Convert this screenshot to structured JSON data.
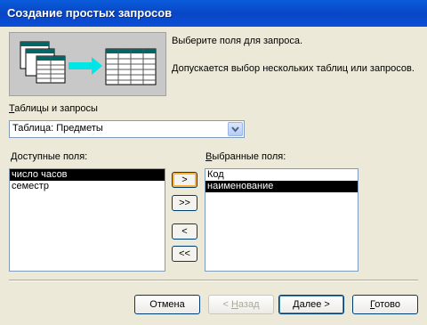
{
  "window": {
    "title": "Создание простых запросов"
  },
  "intro": {
    "line1": "Выберите поля для запроса.",
    "line2": "Допускается выбор нескольких таблиц или запросов."
  },
  "source": {
    "label": "Таблицы и запросы",
    "label_accel": "Т",
    "label_rest": "аблицы и запросы",
    "selected": "Таблица: Предметы"
  },
  "available": {
    "label_accel": "Д",
    "label_rest": "оступные поля:",
    "items": [
      "число часов",
      "семестр"
    ],
    "selected_index": 0
  },
  "chosen": {
    "label_accel": "В",
    "label_rest": "ыбранные поля:",
    "items": [
      "Код",
      "наименование"
    ],
    "selected_index": 1
  },
  "move_buttons": {
    "add_one": ">",
    "add_all": ">>",
    "remove_one": "<",
    "remove_all": "<<"
  },
  "footer": {
    "cancel": "Отмена",
    "back_prefix": "< ",
    "back_accel": "Н",
    "back_rest": "азад",
    "next_prefix": "",
    "next_accel": "Д",
    "next_rest": "алее >",
    "finish_accel": "Г",
    "finish_rest": "отово"
  },
  "colors": {
    "titlebar": "#0a5ddc",
    "dialog_bg": "#ece9d8",
    "selection": "#000000"
  }
}
